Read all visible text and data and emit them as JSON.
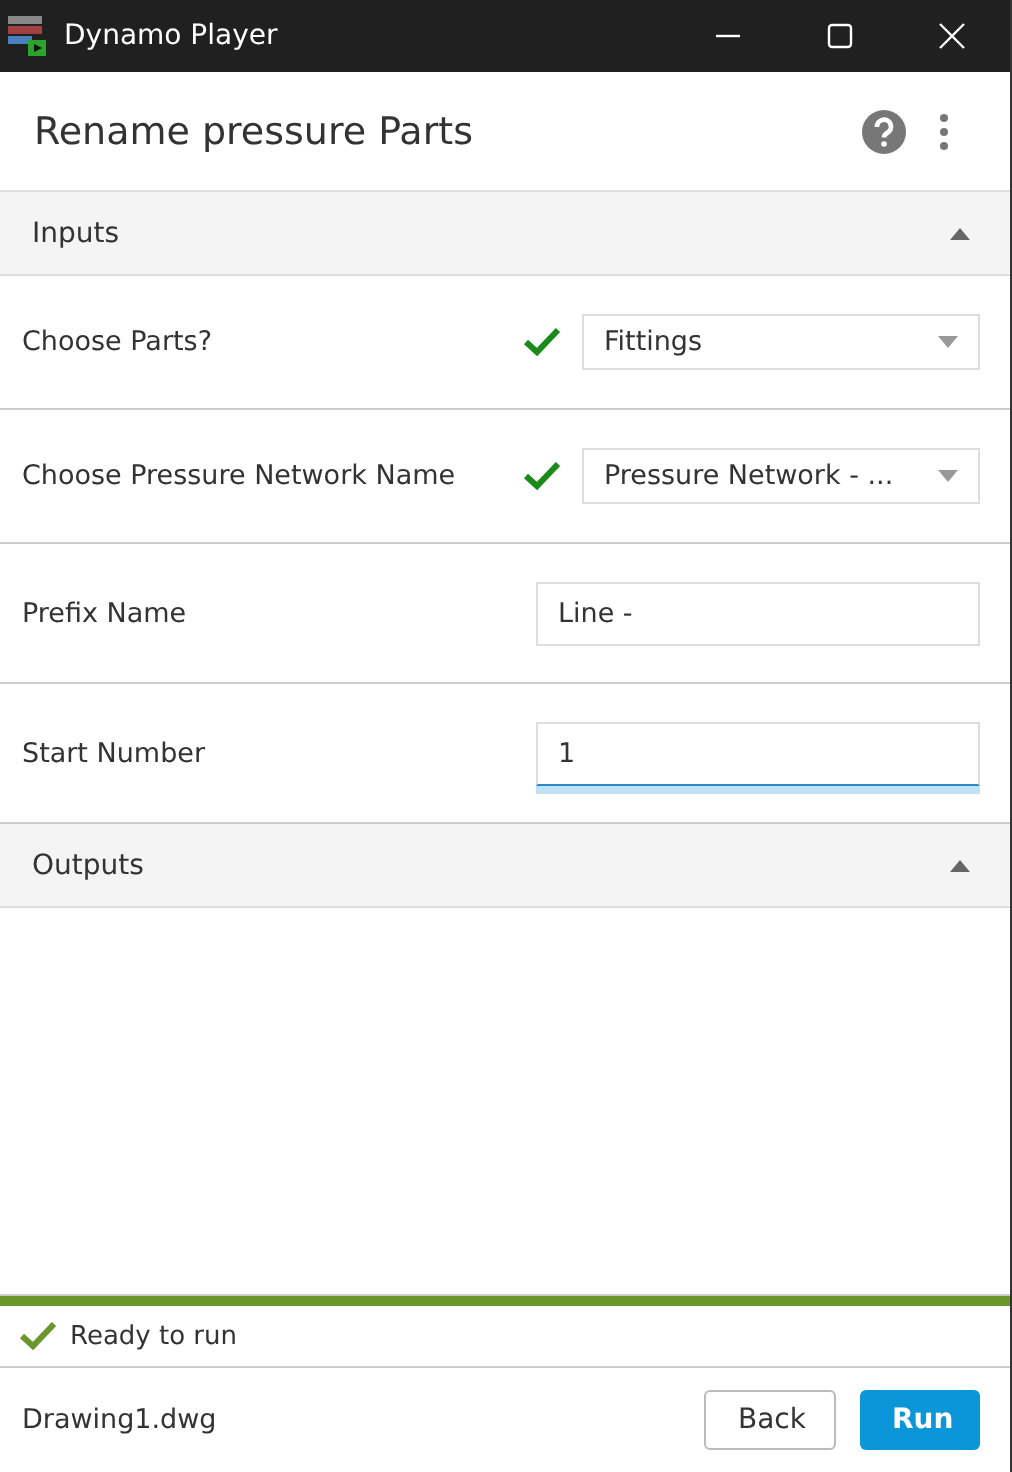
{
  "window": {
    "title": "Dynamo Player"
  },
  "header": {
    "title": "Rename pressure Parts"
  },
  "sections": [
    {
      "title": "Inputs",
      "expanded": true,
      "inputs": [
        {
          "kind": "dropdown",
          "label": "Choose Parts?",
          "value": "Fittings",
          "valid": true
        },
        {
          "kind": "dropdown",
          "label": "Choose Pressure Network Name",
          "value": "Pressure Network - ...",
          "valid": true
        },
        {
          "kind": "text",
          "label": "Prefix Name",
          "value": "Line -",
          "focused": false
        },
        {
          "kind": "text",
          "label": "Start Number",
          "value": "1",
          "focused": true
        }
      ]
    },
    {
      "title": "Outputs",
      "expanded": true
    }
  ],
  "progress": {
    "level": 1
  },
  "status": {
    "text": "Ready to run"
  },
  "footer": {
    "file": "Drawing1.dwg",
    "buttons": [
      {
        "label": "Back",
        "kind": "secondary"
      },
      {
        "label": "Run",
        "kind": "primary"
      }
    ]
  }
}
